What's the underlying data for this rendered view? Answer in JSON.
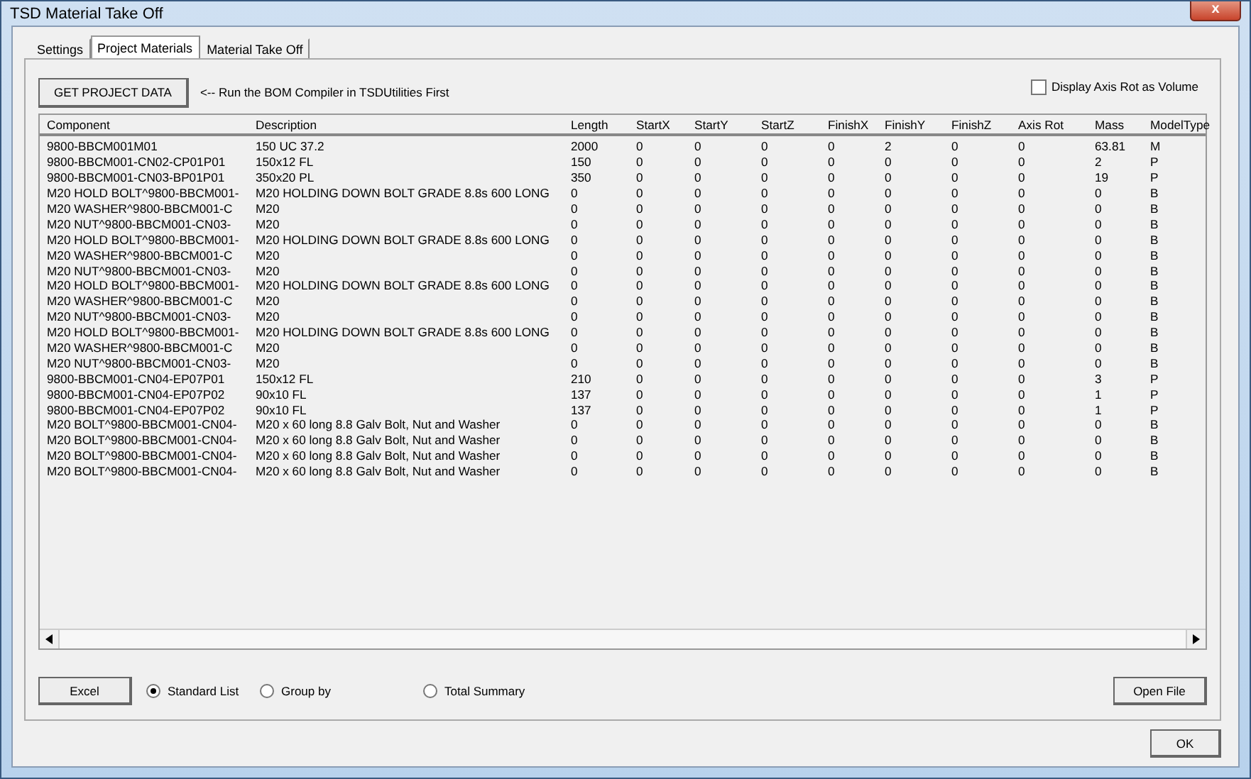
{
  "window": {
    "title": "TSD Material Take Off",
    "close": "x"
  },
  "tabs": [
    {
      "label": "Settings",
      "selected": false
    },
    {
      "label": "Project Materials",
      "selected": true
    },
    {
      "label": "Material Take Off",
      "selected": false
    }
  ],
  "get_data_button": "GET PROJECT DATA",
  "hint": "<-- Run the BOM Compiler in TSDUtilities First",
  "axis_rot_volume": {
    "label": "Display Axis Rot as Volume",
    "checked": false
  },
  "table": {
    "columns": [
      "Component",
      "Description",
      "Length",
      "StartX",
      "StartY",
      "StartZ",
      "FinishX",
      "FinishY",
      "FinishZ",
      "Axis Rot",
      "Mass",
      "ModelType"
    ],
    "rows": [
      [
        "9800-BBCM001M01",
        "150 UC 37.2",
        "2000",
        "0",
        "0",
        "0",
        "0",
        "2",
        "0",
        "0",
        "63.81",
        "M"
      ],
      [
        "9800-BBCM001-CN02-CP01P01",
        "150x12 FL",
        "150",
        "0",
        "0",
        "0",
        "0",
        "0",
        "0",
        "0",
        "2",
        "P"
      ],
      [
        "9800-BBCM001-CN03-BP01P01",
        "350x20 PL",
        "350",
        "0",
        "0",
        "0",
        "0",
        "0",
        "0",
        "0",
        "19",
        "P"
      ],
      [
        "M20 HOLD BOLT^9800-BBCM001-",
        "M20 HOLDING DOWN BOLT GRADE 8.8s 600 LONG",
        "0",
        "0",
        "0",
        "0",
        "0",
        "0",
        "0",
        "0",
        "0",
        "B"
      ],
      [
        "M20 WASHER^9800-BBCM001-C",
        "M20",
        "0",
        "0",
        "0",
        "0",
        "0",
        "0",
        "0",
        "0",
        "0",
        "B"
      ],
      [
        "M20 NUT^9800-BBCM001-CN03-",
        "M20",
        "0",
        "0",
        "0",
        "0",
        "0",
        "0",
        "0",
        "0",
        "0",
        "B"
      ],
      [
        "M20 HOLD BOLT^9800-BBCM001-",
        "M20 HOLDING DOWN BOLT GRADE 8.8s 600 LONG",
        "0",
        "0",
        "0",
        "0",
        "0",
        "0",
        "0",
        "0",
        "0",
        "B"
      ],
      [
        "M20 WASHER^9800-BBCM001-C",
        "M20",
        "0",
        "0",
        "0",
        "0",
        "0",
        "0",
        "0",
        "0",
        "0",
        "B"
      ],
      [
        "M20 NUT^9800-BBCM001-CN03-",
        "M20",
        "0",
        "0",
        "0",
        "0",
        "0",
        "0",
        "0",
        "0",
        "0",
        "B"
      ],
      [
        "M20 HOLD BOLT^9800-BBCM001-",
        "M20 HOLDING DOWN BOLT GRADE 8.8s 600 LONG",
        "0",
        "0",
        "0",
        "0",
        "0",
        "0",
        "0",
        "0",
        "0",
        "B"
      ],
      [
        "M20 WASHER^9800-BBCM001-C",
        "M20",
        "0",
        "0",
        "0",
        "0",
        "0",
        "0",
        "0",
        "0",
        "0",
        "B"
      ],
      [
        "M20 NUT^9800-BBCM001-CN03-",
        "M20",
        "0",
        "0",
        "0",
        "0",
        "0",
        "0",
        "0",
        "0",
        "0",
        "B"
      ],
      [
        "M20 HOLD BOLT^9800-BBCM001-",
        "M20 HOLDING DOWN BOLT GRADE 8.8s 600 LONG",
        "0",
        "0",
        "0",
        "0",
        "0",
        "0",
        "0",
        "0",
        "0",
        "B"
      ],
      [
        "M20 WASHER^9800-BBCM001-C",
        "M20",
        "0",
        "0",
        "0",
        "0",
        "0",
        "0",
        "0",
        "0",
        "0",
        "B"
      ],
      [
        "M20 NUT^9800-BBCM001-CN03-",
        "M20",
        "0",
        "0",
        "0",
        "0",
        "0",
        "0",
        "0",
        "0",
        "0",
        "B"
      ],
      [
        "9800-BBCM001-CN04-EP07P01",
        "150x12 FL",
        "210",
        "0",
        "0",
        "0",
        "0",
        "0",
        "0",
        "0",
        "3",
        "P"
      ],
      [
        "9800-BBCM001-CN04-EP07P02",
        "90x10 FL",
        "137",
        "0",
        "0",
        "0",
        "0",
        "0",
        "0",
        "0",
        "1",
        "P"
      ],
      [
        "9800-BBCM001-CN04-EP07P02",
        "90x10 FL",
        "137",
        "0",
        "0",
        "0",
        "0",
        "0",
        "0",
        "0",
        "1",
        "P"
      ],
      [
        "M20 BOLT^9800-BBCM001-CN04-",
        "M20 x 60 long 8.8 Galv Bolt, Nut and Washer",
        "0",
        "0",
        "0",
        "0",
        "0",
        "0",
        "0",
        "0",
        "0",
        "B"
      ],
      [
        "M20 BOLT^9800-BBCM001-CN04-",
        "M20 x 60 long 8.8 Galv Bolt, Nut and Washer",
        "0",
        "0",
        "0",
        "0",
        "0",
        "0",
        "0",
        "0",
        "0",
        "B"
      ],
      [
        "M20 BOLT^9800-BBCM001-CN04-",
        "M20 x 60 long 8.8 Galv Bolt, Nut and Washer",
        "0",
        "0",
        "0",
        "0",
        "0",
        "0",
        "0",
        "0",
        "0",
        "B"
      ],
      [
        "M20 BOLT^9800-BBCM001-CN04-",
        "M20 x 60 long 8.8 Galv Bolt, Nut and Washer",
        "0",
        "0",
        "0",
        "0",
        "0",
        "0",
        "0",
        "0",
        "0",
        "B"
      ]
    ]
  },
  "excel_button": "Excel",
  "list_options": [
    {
      "label": "Standard List",
      "selected": true
    },
    {
      "label": "Group by",
      "selected": false
    },
    {
      "label": "Total Summary",
      "selected": false
    }
  ],
  "open_file_button": "Open File",
  "ok_button": "OK"
}
